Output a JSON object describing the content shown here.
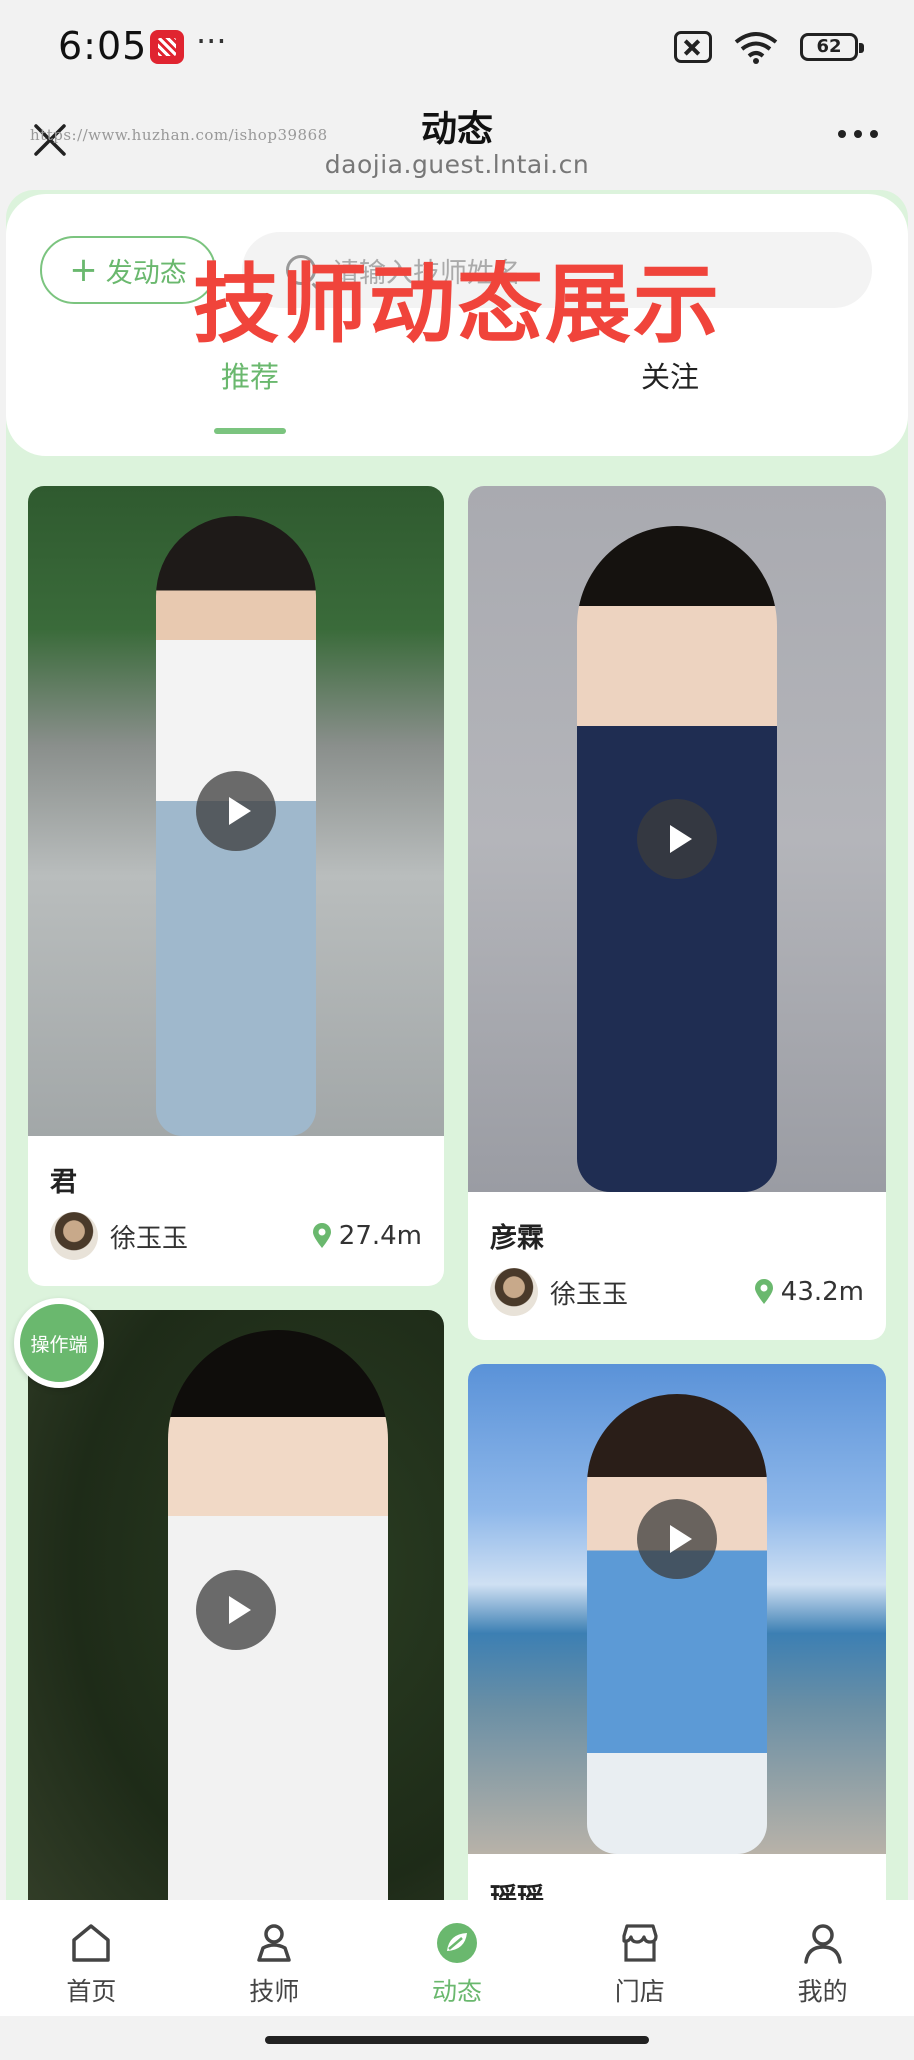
{
  "status_bar": {
    "time": "6:05",
    "dots": "···",
    "battery": "62"
  },
  "header": {
    "title": "动态",
    "subtitle": "daojia.guest.lntai.cn",
    "watermark_url": "https://www.huzhan.com/ishop39868"
  },
  "toolbar": {
    "post_label": "发动态",
    "search_placeholder": "请输入技师姓名"
  },
  "overlay": {
    "text": "技师动态展示"
  },
  "tabs": [
    {
      "label": "推荐",
      "active": true
    },
    {
      "label": "关注",
      "active": false
    }
  ],
  "cards": [
    {
      "title": "君",
      "author": "徐玉玉",
      "distance": "27.4m",
      "has_video": true
    },
    {
      "title": "彦霖",
      "author": "徐玉玉",
      "distance": "43.2m",
      "has_video": true
    },
    {
      "title": "",
      "author": "",
      "distance": "",
      "has_video": true
    },
    {
      "title": "瑶瑶",
      "author": "",
      "distance": "",
      "has_video": true
    }
  ],
  "floating": {
    "operator_label": "操作端"
  },
  "bottom_nav": [
    {
      "label": "首页",
      "icon": "home-icon",
      "active": false
    },
    {
      "label": "技师",
      "icon": "technician-icon",
      "active": false
    },
    {
      "label": "动态",
      "icon": "feed-leaf-icon",
      "active": true
    },
    {
      "label": "门店",
      "icon": "store-icon",
      "active": false
    },
    {
      "label": "我的",
      "icon": "profile-icon",
      "active": false
    }
  ],
  "colors": {
    "accent": "#6ab86e",
    "page_bg": "#dcf3dc",
    "overlay_red": "#f0443b"
  }
}
